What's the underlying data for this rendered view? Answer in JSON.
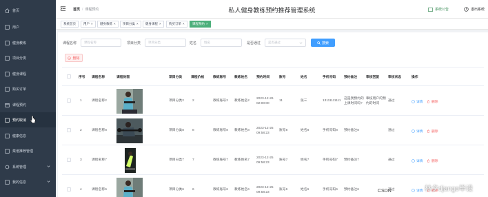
{
  "app": {
    "title": "私人健身教练预约推荐管理系统"
  },
  "sidebar": {
    "items": [
      {
        "label": "首页",
        "icon": "home-icon"
      },
      {
        "label": "用户",
        "icon": "user-icon"
      },
      {
        "label": "健身教练",
        "icon": "coach-icon"
      },
      {
        "label": "项目分类",
        "icon": "category-icon"
      },
      {
        "label": "健身课程",
        "icon": "course-icon"
      },
      {
        "label": "购买订单",
        "icon": "order-icon"
      },
      {
        "label": "课程预约",
        "icon": "calendar-icon"
      },
      {
        "label": "预约取消",
        "icon": "cancel-icon"
      },
      {
        "label": "健康信息",
        "icon": "health-icon"
      },
      {
        "label": "菜谱推荐管理",
        "icon": "recipe-icon"
      },
      {
        "label": "系统管理",
        "icon": "settings-icon"
      },
      {
        "label": "我的信息",
        "icon": "profile-icon"
      }
    ]
  },
  "header": {
    "breadcrumb_home": "首页",
    "breadcrumb_current": "课程预约",
    "notice_label": "系统公告",
    "logout_label": "退出系统"
  },
  "tabs": [
    {
      "label": "系统首页"
    },
    {
      "label": "用户"
    },
    {
      "label": "健身教练"
    },
    {
      "label": "项目分类"
    },
    {
      "label": "健身课程"
    },
    {
      "label": "购买订单"
    },
    {
      "label": "课程预约"
    }
  ],
  "search": {
    "course_name_label": "课程名称",
    "course_name_placeholder": "课程名称",
    "category_label": "项目分类",
    "category_placeholder": "项目分类",
    "name_label": "姓名",
    "name_placeholder": "姓名",
    "passed_label": "是否通过",
    "passed_placeholder": "是否通过",
    "search_button": "搜索",
    "delete_button": "删除"
  },
  "table": {
    "columns": [
      "序号",
      "课程名称",
      "课程封面",
      "项目分类",
      "课程价格",
      "教练账号",
      "教练姓名",
      "预约时间",
      "账号",
      "姓名",
      "手机号码",
      "预约备注",
      "审核回复",
      "审核状态",
      "操作"
    ],
    "edit_label": "详情",
    "delete_label": "删除",
    "rows": [
      {
        "index": "1",
        "course": "课程名称2",
        "category": "项目分类2",
        "price": "2",
        "coach_account": "教练账号2",
        "coach_name": "教练姓名2",
        "time": "2023-12-26 02:00:00",
        "account": "11",
        "name": "张三",
        "phone": "13111111111",
        "note": "这是我预约的上课时间吗?",
        "reply": "审核用户的预约的时间",
        "status": "通过",
        "cover": "fitness-woman-dumbbell"
      },
      {
        "index": "2",
        "course": "课程名称8",
        "category": "项目分类8",
        "price": "8",
        "coach_account": "教练账号8",
        "coach_name": "教练姓名8",
        "time": "2023-12-25 09:58:23",
        "account": "账号8",
        "name": "姓名8",
        "phone": "手机号码8",
        "note": "预约备注8",
        "reply": "",
        "status": "通过",
        "cover": "fitness-man-dumbbell"
      },
      {
        "index": "3",
        "course": "课程名称7",
        "category": "项目分类7",
        "price": "7",
        "coach_account": "教练账号7",
        "coach_name": "教练姓名7",
        "time": "2023-12-25 09:58:23",
        "account": "账号7",
        "name": "姓名7",
        "phone": "手机号码7",
        "note": "预约备注7",
        "reply": "",
        "status": "通过",
        "cover": "fitness-pushup"
      },
      {
        "index": "4",
        "course": "课程名称6",
        "category": "项目分类6",
        "price": "6",
        "coach_account": "教练账号6",
        "coach_name": "教练姓名6",
        "time": "2023-12-25 09:58:23",
        "account": "账号6",
        "name": "姓名6",
        "phone": "手机号码6",
        "note": "预约备注6",
        "reply": "",
        "status": "通过",
        "cover": "fitness-woman-dumbbell"
      }
    ]
  },
  "watermark": {
    "text": "林夕django毕设",
    "source": "CSDN"
  },
  "colors": {
    "sidebar_bg": "#2f3b4a",
    "accent": "#4caf7a",
    "primary": "#409eff",
    "danger": "#f56c6c"
  }
}
